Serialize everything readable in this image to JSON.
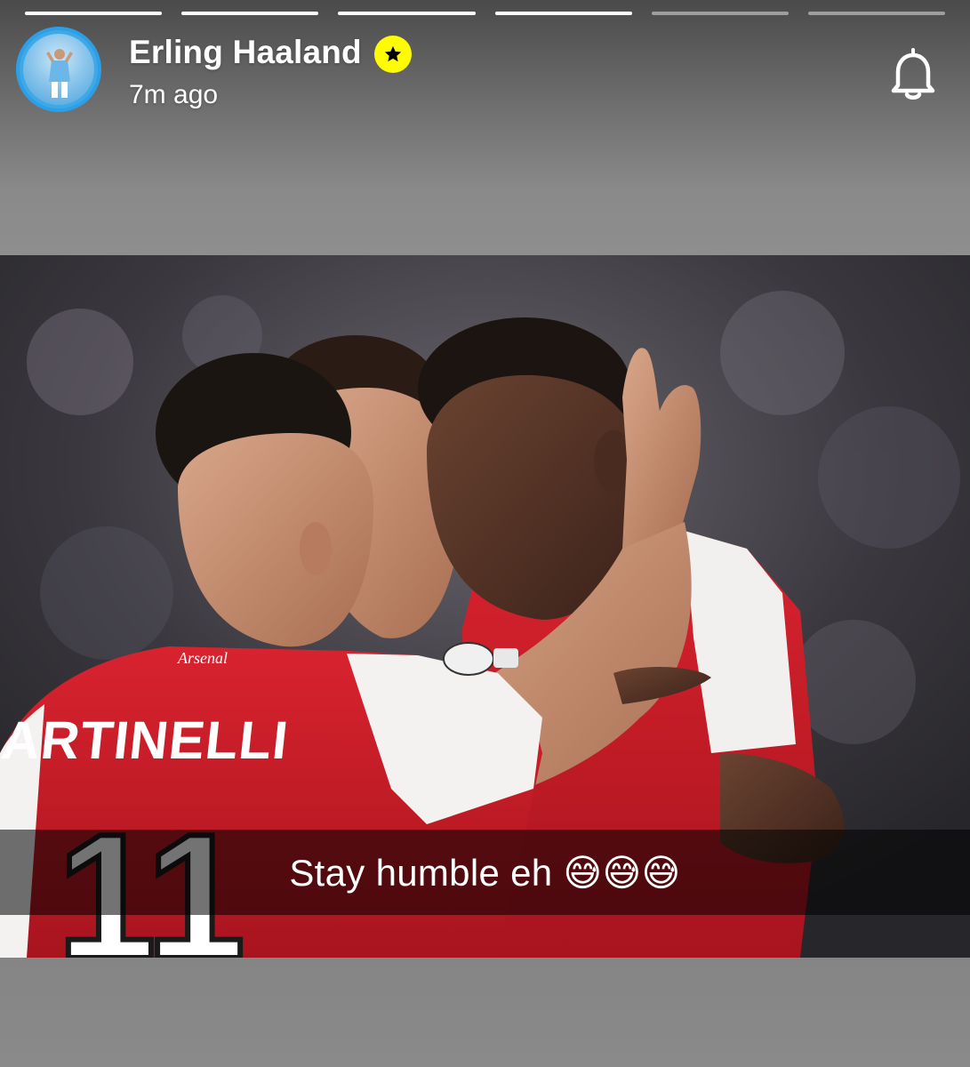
{
  "story": {
    "progress_segments": [
      {
        "filled": 1.0
      },
      {
        "filled": 1.0
      },
      {
        "filled": 1.0
      },
      {
        "filled": 1.0
      },
      {
        "filled": 0.0
      },
      {
        "filled": 0.0
      }
    ]
  },
  "header": {
    "username": "Erling Haaland",
    "badge_icon": "star-icon",
    "badge_color": "#fffc00",
    "timestamp": "7m ago",
    "notification_icon": "bell-icon"
  },
  "media": {
    "jersey_sponsor": "Arsenal",
    "jersey_name": "MARTINELLI",
    "jersey_number": "11"
  },
  "caption": {
    "text": "Stay humble eh 😅😅😅"
  },
  "colors": {
    "arsenal_red": "#d21f2b",
    "caption_bg": "rgba(0,0,0,0.55)",
    "avatar_ring": "#2d9fe6"
  }
}
